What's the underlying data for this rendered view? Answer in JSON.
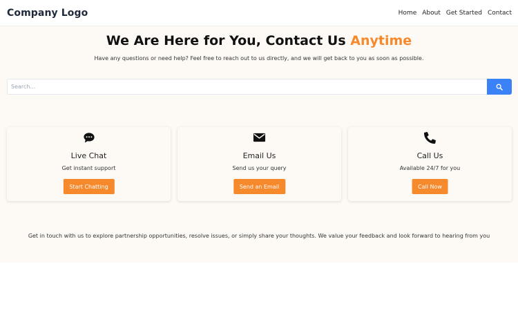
{
  "navbar": {
    "logo": "Company Logo",
    "links": [
      "Home",
      "About",
      "Get Started",
      "Contact"
    ]
  },
  "hero": {
    "headline_main": "We Are Here for You, Contact Us ",
    "headline_accent": "Anytime",
    "subtext": "Have any questions or need help? Feel free to reach out to us directly, and we will get back to you as soon as possible."
  },
  "search": {
    "placeholder": "Search...",
    "value": "",
    "icon": "search-icon"
  },
  "cards": [
    {
      "icon": "chat-bubble-icon",
      "title": "Live Chat",
      "description": "Get instant support",
      "button": "Start Chatting"
    },
    {
      "icon": "envelope-icon",
      "title": "Email Us",
      "description": "Send us your query",
      "button": "Send an Email"
    },
    {
      "icon": "phone-icon",
      "title": "Call Us",
      "description": "Available 24/7 for you",
      "button": "Call Now"
    }
  ],
  "footer_text": "Get in touch with us to explore partnership opportunities, resolve issues, or simply share your thoughts. We value your feedback and look forward to hearing from you",
  "colors": {
    "accent": "#f7892d",
    "search_button": "#3b82f6",
    "hero_background": "#fdfaf5",
    "logo": "#1e2a3b"
  }
}
